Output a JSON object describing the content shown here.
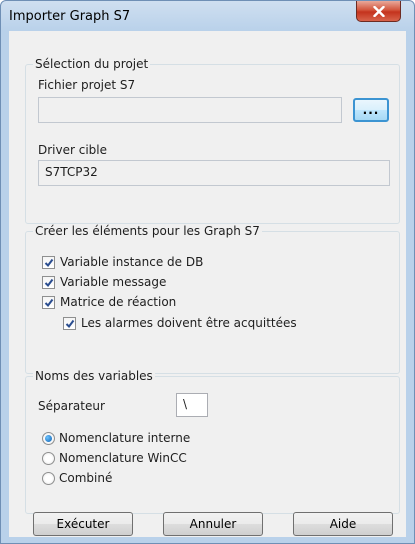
{
  "window": {
    "title": "Importer Graph S7"
  },
  "project": {
    "group_title": "Sélection du projet",
    "file_label": "Fichier projet S7",
    "file_value": "",
    "browse_label": "...",
    "driver_label": "Driver cible",
    "driver_value": "S7TCP32"
  },
  "create": {
    "group_title": "Créer les éléments pour les Graph S7",
    "items": [
      {
        "label": "Variable instance de DB",
        "checked": true
      },
      {
        "label": "Variable message",
        "checked": true
      },
      {
        "label": "Matrice de réaction",
        "checked": true
      },
      {
        "label": "Les alarmes doivent être acquittées",
        "checked": true
      }
    ]
  },
  "names": {
    "group_title": "Noms des variables",
    "separator_label": "Séparateur",
    "separator_value": "\\",
    "options": [
      {
        "label": "Nomenclature interne",
        "selected": true
      },
      {
        "label": "Nomenclature WinCC",
        "selected": false
      },
      {
        "label": "Combiné",
        "selected": false
      }
    ]
  },
  "buttons": {
    "execute": "Exécuter",
    "cancel": "Annuler",
    "help": "Aide"
  },
  "colors": {
    "title_bar": "#b9d1ea",
    "close_button": "#c4331d",
    "dialog_background": "#f0f0f0",
    "accent": "#3c94d2"
  }
}
